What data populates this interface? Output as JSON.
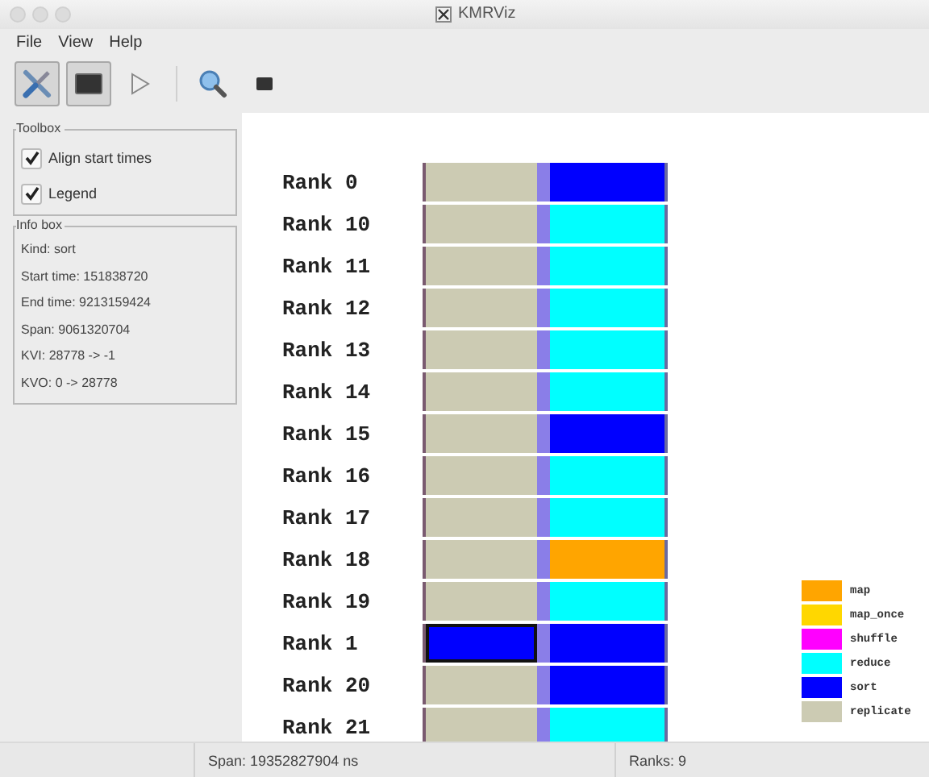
{
  "window": {
    "title": "KMRViz"
  },
  "menu": [
    "File",
    "View",
    "Help"
  ],
  "toolbar": [
    {
      "kind": "tools",
      "pressed": true
    },
    {
      "kind": "display",
      "pressed": true
    },
    {
      "kind": "play",
      "pressed": false
    },
    {
      "kind": "separator"
    },
    {
      "kind": "zoom",
      "pressed": false
    },
    {
      "kind": "screen",
      "pressed": false
    }
  ],
  "toolbox": {
    "title": "Toolbox",
    "options": [
      {
        "label": "Align start times",
        "checked": true
      },
      {
        "label": "Legend",
        "checked": true
      }
    ]
  },
  "info_box": {
    "title": "Info box",
    "lines": [
      "Kind: sort",
      "Start time: 151838720",
      "End time: 9213159424",
      "Span: 9061320704",
      "KVI: 28778 -> -1",
      "KVO: 0 -> 28778"
    ]
  },
  "ranks": [
    {
      "label": "Rank 0",
      "segments": [
        {
          "color": "#cccbb3",
          "selected": false
        },
        {
          "color": "#0000ff",
          "selected": false
        }
      ]
    },
    {
      "label": "Rank 10",
      "segments": [
        {
          "color": "#cccbb3",
          "selected": false
        },
        {
          "color": "#00ffff",
          "selected": false
        }
      ]
    },
    {
      "label": "Rank 11",
      "segments": [
        {
          "color": "#cccbb3",
          "selected": false
        },
        {
          "color": "#00ffff",
          "selected": false
        }
      ]
    },
    {
      "label": "Rank 12",
      "segments": [
        {
          "color": "#cccbb3",
          "selected": false
        },
        {
          "color": "#00ffff",
          "selected": false
        }
      ]
    },
    {
      "label": "Rank 13",
      "segments": [
        {
          "color": "#cccbb3",
          "selected": false
        },
        {
          "color": "#00ffff",
          "selected": false
        }
      ]
    },
    {
      "label": "Rank 14",
      "segments": [
        {
          "color": "#cccbb3",
          "selected": false
        },
        {
          "color": "#00ffff",
          "selected": false
        }
      ]
    },
    {
      "label": "Rank 15",
      "segments": [
        {
          "color": "#cccbb3",
          "selected": false
        },
        {
          "color": "#0000ff",
          "selected": false
        }
      ]
    },
    {
      "label": "Rank 16",
      "segments": [
        {
          "color": "#cccbb3",
          "selected": false
        },
        {
          "color": "#00ffff",
          "selected": false
        }
      ]
    },
    {
      "label": "Rank 17",
      "segments": [
        {
          "color": "#cccbb3",
          "selected": false
        },
        {
          "color": "#00ffff",
          "selected": false
        }
      ]
    },
    {
      "label": "Rank 18",
      "segments": [
        {
          "color": "#cccbb3",
          "selected": false
        },
        {
          "color": "#ffa500",
          "selected": false
        }
      ]
    },
    {
      "label": "Rank 19",
      "segments": [
        {
          "color": "#cccbb3",
          "selected": false
        },
        {
          "color": "#00ffff",
          "selected": false
        }
      ]
    },
    {
      "label": "Rank 1",
      "segments": [
        {
          "color": "#0000ff",
          "selected": true
        },
        {
          "color": "#0000ff",
          "selected": false
        }
      ]
    },
    {
      "label": "Rank 20",
      "segments": [
        {
          "color": "#cccbb3",
          "selected": false
        },
        {
          "color": "#0000ff",
          "selected": false
        }
      ]
    },
    {
      "label": "Rank 21",
      "segments": [
        {
          "color": "#cccbb3",
          "selected": false
        },
        {
          "color": "#00ffff",
          "selected": false
        }
      ]
    }
  ],
  "legend": [
    {
      "label": "map",
      "color": "#ffa500"
    },
    {
      "label": "map_once",
      "color": "#ffd700"
    },
    {
      "label": "shuffle",
      "color": "#ff00ff"
    },
    {
      "label": "reduce",
      "color": "#00ffff"
    },
    {
      "label": "sort",
      "color": "#0000ff"
    },
    {
      "label": "replicate",
      "color": "#cccbb3"
    }
  ],
  "status_bar": {
    "span": "Span: 19352827904 ns",
    "ranks": "Ranks: 9"
  }
}
